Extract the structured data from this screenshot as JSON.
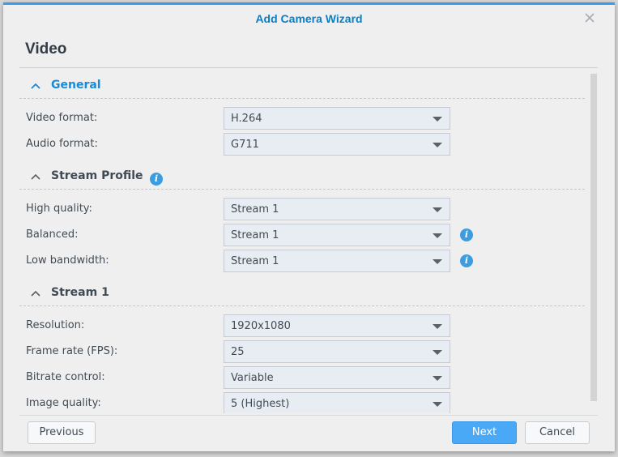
{
  "dialog": {
    "title": "Add Camera Wizard",
    "close_icon": "close-icon",
    "page_heading": "Video"
  },
  "colors": {
    "accent": "#3d9ae8",
    "title": "#0b7ec4",
    "primary_button": "#4aa9f6",
    "info_icon": "#3a9de0"
  },
  "sections": {
    "general": {
      "title": "General",
      "expanded": true,
      "fields": [
        {
          "label": "Video format:",
          "value": "H.264"
        },
        {
          "label": "Audio format:",
          "value": "G711"
        }
      ]
    },
    "stream_profile": {
      "title": "Stream Profile",
      "expanded": true,
      "info_icon": "info-icon",
      "fields": [
        {
          "label": "High quality:",
          "value": "Stream 1"
        },
        {
          "label": "Balanced:",
          "value": "Stream 1",
          "info": true
        },
        {
          "label": "Low bandwidth:",
          "value": "Stream 1",
          "info": true
        }
      ]
    },
    "stream1": {
      "title": "Stream 1",
      "expanded": true,
      "fields": [
        {
          "label": "Resolution:",
          "value": "1920x1080"
        },
        {
          "label": "Frame rate (FPS):",
          "value": "25"
        },
        {
          "label": "Bitrate control:",
          "value": "Variable"
        },
        {
          "label": "Image quality:",
          "value": "5 (Highest)"
        }
      ]
    }
  },
  "info_glyph": "i",
  "footer": {
    "previous_label": "Previous",
    "next_label": "Next",
    "cancel_label": "Cancel"
  }
}
